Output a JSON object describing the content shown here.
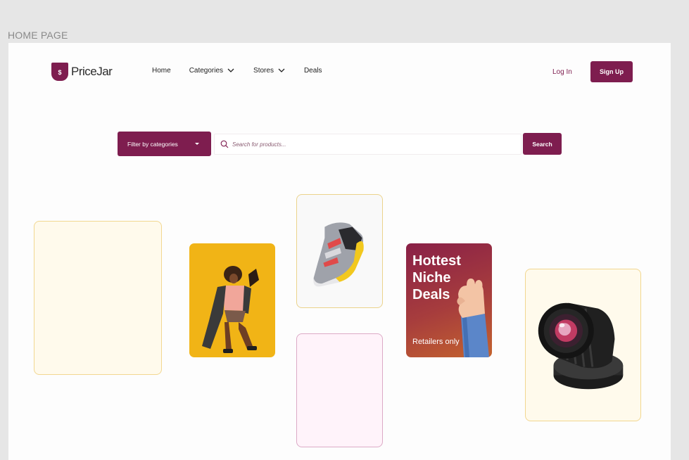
{
  "frame_label": "HOME PAGE",
  "brand": {
    "name": "PriceJar",
    "mark": "$",
    "color": "#7e1d4f"
  },
  "nav": {
    "items": [
      {
        "label": "Home",
        "has_dropdown": false
      },
      {
        "label": "Categories",
        "has_dropdown": true
      },
      {
        "label": "Stores",
        "has_dropdown": true
      },
      {
        "label": "Deals",
        "has_dropdown": false
      }
    ],
    "login_label": "Log In",
    "signup_label": "Sign Up"
  },
  "search": {
    "filter_label": "Filter by categories",
    "placeholder": "Search for products...",
    "button_label": "Search"
  },
  "promo": {
    "title": "Hottest Niche Deals",
    "subtitle": "Retailers only"
  },
  "cards": [
    {
      "name": "empty-card-cream",
      "icon": "none"
    },
    {
      "name": "fashion-card",
      "icon": "dancing-woman-image"
    },
    {
      "name": "sneaker-card",
      "icon": "sneaker-image"
    },
    {
      "name": "empty-card-pink",
      "icon": "none"
    },
    {
      "name": "promo-card",
      "icon": "hand-image"
    },
    {
      "name": "camera-lens-card",
      "icon": "camera-lens-image"
    }
  ]
}
